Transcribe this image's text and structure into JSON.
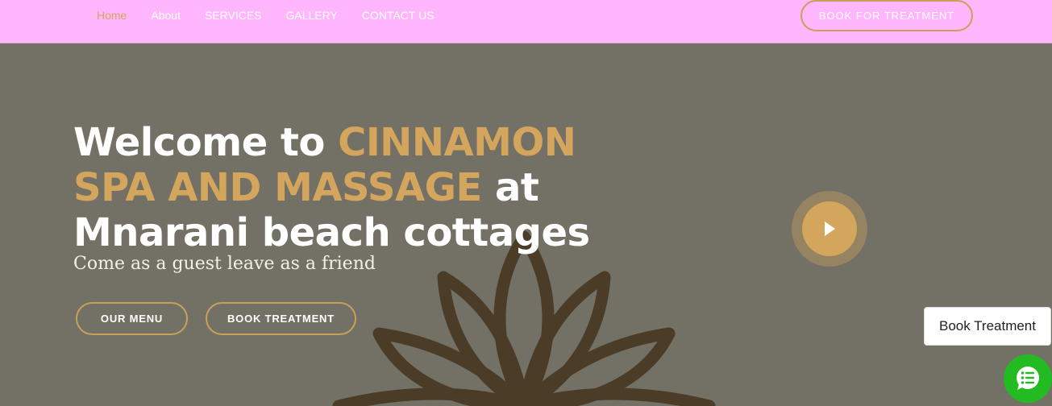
{
  "nav": {
    "items": [
      {
        "label": "Home",
        "active": true
      },
      {
        "label": "About",
        "active": false
      },
      {
        "label": "SERVICES",
        "active": false
      },
      {
        "label": "GALLERY",
        "active": false
      },
      {
        "label": "CONTACT US",
        "active": false
      }
    ],
    "book_label": "BOOK FOR TREATMENT"
  },
  "hero": {
    "headline_pre": "Welcome to ",
    "headline_accent": "CINNAMON SPA AND MASSAGE",
    "headline_post": " at Mnarani beach cottages",
    "tagline": "Come as a guest leave as a friend",
    "menu_button": "OUR MENU",
    "book_button": "BOOK TREATMENT",
    "play_icon": "play-icon",
    "background_icon": "lotus-icon"
  },
  "floating": {
    "book_label": "Book Treatment",
    "chat_icon": "chat-list-icon"
  },
  "colors": {
    "topbar": "#ffb6fd",
    "accent": "#d4a55c",
    "hero_bg": "#737065",
    "chat": "#22bb22"
  }
}
